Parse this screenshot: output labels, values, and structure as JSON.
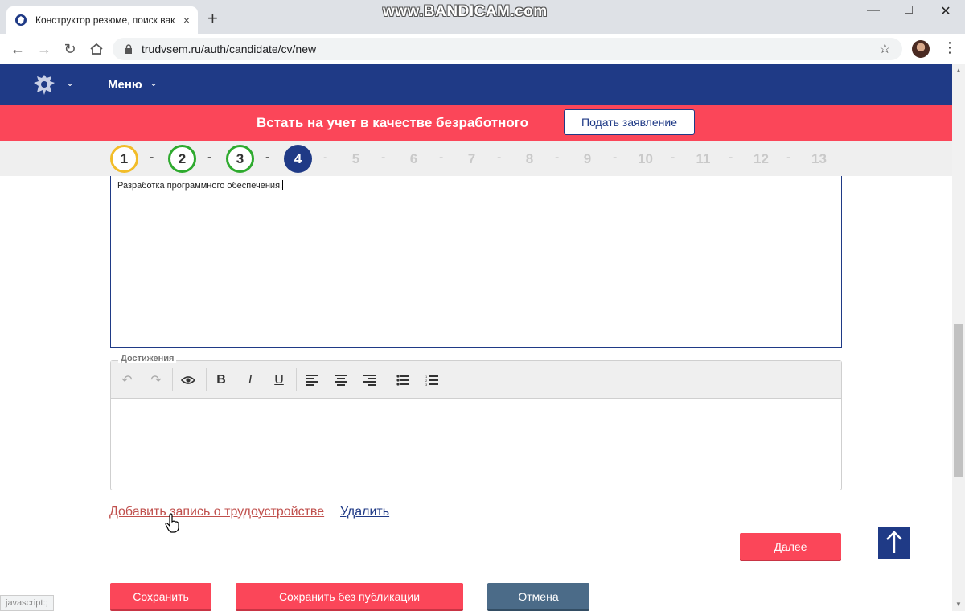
{
  "browser": {
    "tab_title": "Конструктор резюме, поиск вак",
    "tab_close": "×",
    "new_tab": "+",
    "url": "trudvsem.ru/auth/candidate/cv/new",
    "watermark": "www.BANDICAM.com",
    "status_text": "javascript:;",
    "icons": [
      "back-icon",
      "forward-icon",
      "reload-icon",
      "home-icon",
      "lock-icon",
      "star-icon",
      "kebab-icon"
    ]
  },
  "header": {
    "menu_label": "Меню"
  },
  "alert": {
    "text": "Встать на учет в качестве безработного",
    "button": "Подать заявление"
  },
  "steps": {
    "items": [
      {
        "label": "1",
        "state": "done-partial"
      },
      {
        "label": "2",
        "state": "done"
      },
      {
        "label": "3",
        "state": "done"
      },
      {
        "label": "4",
        "state": "active"
      },
      {
        "label": "5",
        "state": "future"
      },
      {
        "label": "6",
        "state": "future"
      },
      {
        "label": "7",
        "state": "future"
      },
      {
        "label": "8",
        "state": "future"
      },
      {
        "label": "9",
        "state": "future"
      },
      {
        "label": "10",
        "state": "future"
      },
      {
        "label": "11",
        "state": "future"
      },
      {
        "label": "12",
        "state": "future"
      },
      {
        "label": "13",
        "state": "future"
      }
    ],
    "separator": "-"
  },
  "duties": {
    "value": "Разработка программного обеспечения."
  },
  "achievements": {
    "legend": "Достижения",
    "value": ""
  },
  "actions": {
    "add_record": "Добавить запись о трудоустройстве",
    "delete": "Удалить",
    "next": "Далее",
    "save": "Сохранить",
    "save_unpublished": "Сохранить без публикации",
    "cancel": "Отмена"
  },
  "colors": {
    "brand_blue": "#1f3a86",
    "accent_red": "#fb4659",
    "step_yellow": "#f2bd29",
    "step_green": "#2eaa2e",
    "cancel_slate": "#4b6b88"
  }
}
